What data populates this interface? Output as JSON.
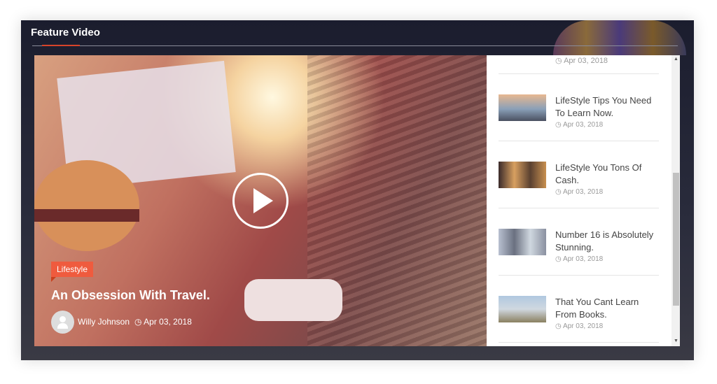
{
  "section": {
    "title": "Feature Video"
  },
  "featured": {
    "category": "Lifestyle",
    "title": "An Obsession With Travel.",
    "author": "Willy Johnson",
    "date": "Apr 03, 2018",
    "accent": "#ef5b3e"
  },
  "list": {
    "top_date": "Apr 03, 2018",
    "items": [
      {
        "title": "LifeStyle Tips You Need To Learn Now.",
        "date": "Apr 03, 2018"
      },
      {
        "title": "LifeStyle You Tons Of Cash.",
        "date": "Apr 03, 2018"
      },
      {
        "title": "Number 16 is Absolutely Stunning.",
        "date": "Apr 03, 2018"
      },
      {
        "title": "That You Cant Learn From Books.",
        "date": "Apr 03, 2018"
      }
    ]
  }
}
